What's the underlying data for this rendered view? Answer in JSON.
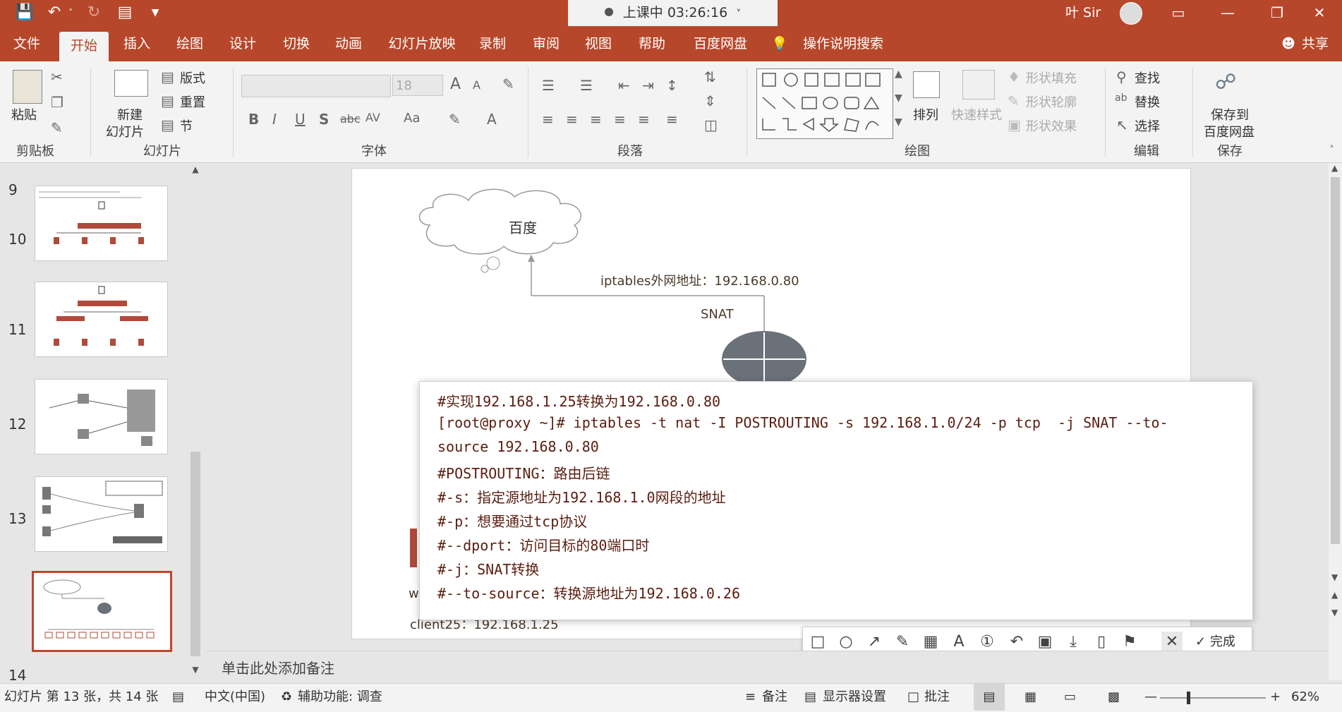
{
  "titlebar": {
    "timer_text": "上课中 03:26:16",
    "user_name": "叶 Sir",
    "icons": [
      "save-icon",
      "undo-icon",
      "redo-icon",
      "present-icon",
      "customize-icon"
    ]
  },
  "menu": {
    "tabs": [
      "文件",
      "开始",
      "插入",
      "绘图",
      "设计",
      "切换",
      "动画",
      "幻灯片放映",
      "录制",
      "审阅",
      "视图",
      "帮助",
      "百度网盘"
    ],
    "active": "开始",
    "tell_me": "操作说明搜索",
    "share": "共享"
  },
  "ribbon": {
    "clipboard": {
      "paste": "粘贴",
      "label": "剪贴板"
    },
    "slides": {
      "new_slide": "新建",
      "new_slide2": "幻灯片",
      "layout": "版式",
      "reset": "重置",
      "section": "节",
      "label": "幻灯片"
    },
    "font": {
      "size": "18",
      "label": "字体",
      "bold": "B",
      "italic": "I",
      "underline": "U",
      "shadow": "S",
      "strike": "abc",
      "spacing": "AV",
      "case": "Aa",
      "color": "A",
      "grow": "A",
      "shrink": "A"
    },
    "paragraph": {
      "label": "段落"
    },
    "drawing": {
      "arrange": "排列",
      "quick_styles": "快速样式",
      "fill": "形状填充",
      "outline": "形状轮廓",
      "effects": "形状效果",
      "label": "绘图"
    },
    "editing": {
      "find": "查找",
      "replace": "替换",
      "select": "选择",
      "label": "编辑"
    },
    "save": {
      "line1": "保存到",
      "line2": "百度网盘",
      "label": "保存"
    }
  },
  "thumbnails": [
    {
      "num": "9"
    },
    {
      "num": "10"
    },
    {
      "num": "11"
    },
    {
      "num": "12"
    },
    {
      "num": "13",
      "selected": true
    },
    {
      "num": "14"
    }
  ],
  "slide": {
    "cloud_label": "百度",
    "wan_label": "iptables外网地址：192.168.0.80",
    "snat_label": "SNAT",
    "client_label": "client25：192.168.1.25",
    "partial_w": "w"
  },
  "code": [
    "#实现192.168.1.25转换为192.168.0.80",
    "[root@proxy ~]# iptables -t nat -I POSTROUTING -s 192.168.1.0/24 -p tcp  -j SNAT --to-",
    "source 192.168.0.80",
    "#POSTROUTING：路由后链",
    "#-s：指定源地址为192.168.1.0网段的地址",
    "#-p：想要通过tcp协议",
    "#--dport：访问目标的80端口时",
    "#-j：SNAT转换",
    "#--to-source：转换源地址为192.168.0.26"
  ],
  "snapbar": {
    "done": "完成"
  },
  "notes": {
    "placeholder": "单击此处添加备注"
  },
  "status": {
    "slide_info": "幻灯片 第 13 张，共 14 张",
    "language": "中文(中国)",
    "accessibility": "辅助功能: 调查",
    "notes_btn": "备注",
    "display_settings": "显示器设置",
    "comments": "批注",
    "zoom": "62%"
  },
  "colors": {
    "accent": "#b7472a",
    "code_text": "#5a1e10"
  }
}
